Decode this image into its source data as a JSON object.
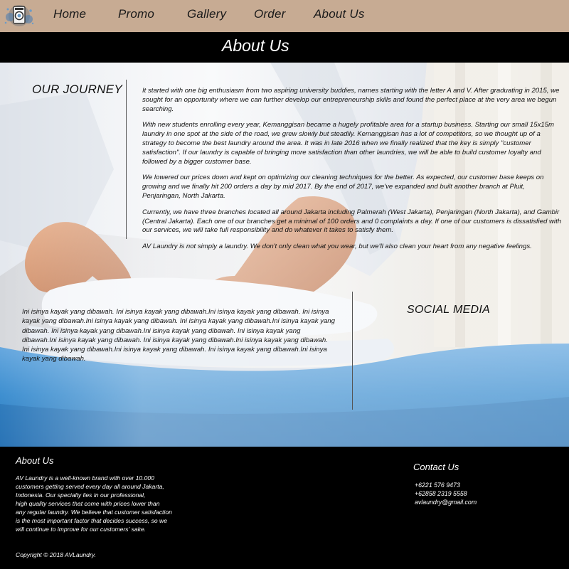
{
  "nav": {
    "items": [
      {
        "label": "Home"
      },
      {
        "label": "Promo"
      },
      {
        "label": "Gallery"
      },
      {
        "label": "Order"
      },
      {
        "label": "About Us"
      }
    ]
  },
  "page_title": "About Us",
  "journey": {
    "title": "OUR JOURNEY",
    "paragraphs": [
      "It started with one big enthusiasm from two aspiring university buddies, names starting with the letter A and V. After graduating in 2015, we sought for an opportunity where we can further develop our entrepreneurship skills and found the perfect place at the very area we begun searching.",
      "With new students enrolling every year, Kemanggisan became a hugely profitable area for a startup business. Starting our small 15x15m laundry in one spot at the side of the road, we grew slowly but steadily. Kemanggisan has a lot of competitors, so we thought up of a strategy to become the best laundry around the area. It was in late 2016 when we finally realized that the key is simply \"customer satisfaction\". If our laundry is capable of bringing more satisfaction than other laundries, we will be able to build customer loyalty and followed by a bigger customer base.",
      "We lowered our prices down and kept on optimizing our cleaning techniques for the better. As expected, our customer base keeps on growing and we finally hit 200 orders a day by mid 2017. By the end of 2017, we've expanded and built another branch at Pluit, Penjaringan, North Jakarta.",
      "Currently, we have three branches located all around Jakarta including Palmerah (West Jakarta), Penjaringan (North Jakarta), and Gambir (Central Jakarta). Each one of our branches get a minimal of 100 orders and 0 complaints a day. If one of our customers is dissatisfied with our services, we will take full responsibility and do whatever it takes to satisfy them.",
      "AV Laundry is not simply a laundry. We don't only clean what you wear, but we'll also clean your heart from any negative feelings."
    ]
  },
  "filler_text": "Ini isinya kayak yang dibawah. Ini isinya kayak yang dibawah.Ini isinya kayak yang dibawah. Ini isinya kayak yang dibawah.Ini isinya kayak yang dibawah. Ini isinya kayak yang dibawah.Ini isinya kayak yang dibawah. Ini isinya kayak yang dibawah.Ini isinya kayak yang dibawah. Ini isinya kayak yang dibawah.Ini isinya kayak yang dibawah. Ini isinya kayak yang dibawah.Ini isinya kayak yang dibawah. Ini isinya kayak yang dibawah.Ini isinya kayak yang dibawah. Ini isinya kayak yang dibawah.Ini isinya kayak yang dibawah.",
  "social_title": "SOCIAL MEDIA",
  "footer": {
    "about_title": "About Us",
    "about_lines": [
      "AV Laundry is a well-known brand with over 10.000",
      "customers getting served every day all around Jakarta,",
      "Indonesia. Our specialty lies in our professional,",
      "high quality services that come with prices lower than",
      "any regular laundry. We believe that customer satisfaction",
      "is the most important factor that decides success, so we",
      "will continue to improve for our customers' sake."
    ],
    "contact_title": "Contact Us",
    "contacts": [
      "+6221 576 9473",
      "+62858 2319 5558",
      "avlaundry@gmail.com"
    ],
    "copyright": "Copyright © 2018 AVLaundry."
  },
  "colors": {
    "nav_bg": "#c7ab93",
    "bar_bg": "#000000",
    "ironing_board": "#3f8fd1",
    "text_dark": "#111111",
    "text_light": "#ffffff"
  },
  "icons": {
    "logo": "laundry-logo-icon"
  }
}
